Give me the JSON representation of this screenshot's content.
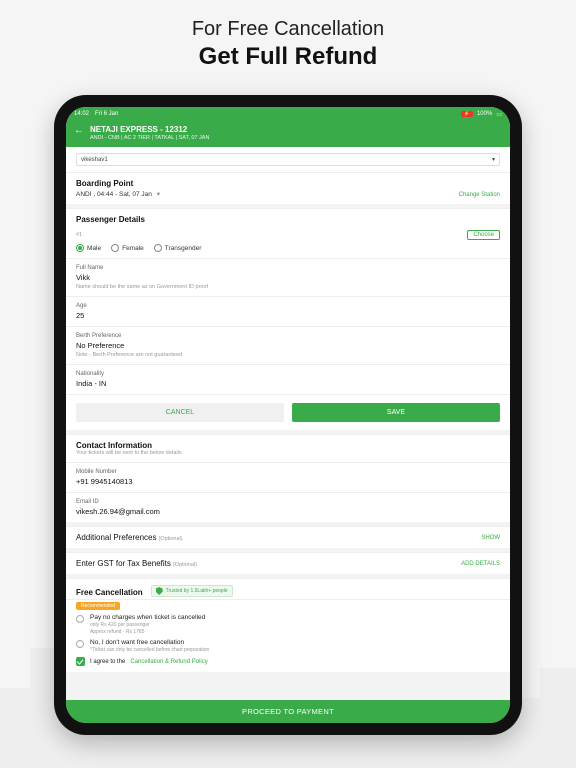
{
  "headline": {
    "line1": "For Free Cancellation",
    "line2": "Get Full Refund"
  },
  "statusbar": {
    "time": "14:02",
    "date": "Fri 6 Jan",
    "battery": "100%"
  },
  "appbar": {
    "back": "←",
    "title": "NETAJI EXPRESS - 12312",
    "subtitle": "ANDI - CNB | AC 2 TIER | TATKAL | SAT, 07 JAN"
  },
  "username_field": {
    "value": "vikeshav1",
    "caret": "▾"
  },
  "boarding": {
    "label": "Boarding Point",
    "value": "ANDI , 04:44 - Sat, 07 Jan",
    "caret": "▾",
    "change": "Change Station"
  },
  "passenger": {
    "heading": "Passenger Details",
    "idx": "#1",
    "choose": "Choose",
    "gender": {
      "male": "Male",
      "female": "Female",
      "trans": "Transgender"
    },
    "fullname_label": "Full Name",
    "fullname_value": "Vikk",
    "fullname_note": "Name should be the same as on Government ID proof",
    "age_label": "Age",
    "age_value": "25",
    "berth_label": "Berth Preference",
    "berth_value": "No Preference",
    "berth_note": "Note - Berth Preference are not guaranteed",
    "nat_label": "Nationality",
    "nat_value": "India - IN",
    "cancel": "CANCEL",
    "save": "SAVE"
  },
  "contact": {
    "heading": "Contact Information",
    "sub": "Your tickets will be sent to the below details",
    "mobile_label": "Mobile Number",
    "mobile_value": "+91 9945140813",
    "email_label": "Email ID",
    "email_value": "vikesh.26.94@gmail.com"
  },
  "addpref": {
    "label": "Additional Preferences",
    "optional": "(Optional)",
    "action": "SHOW"
  },
  "gst": {
    "label": "Enter GST for Tax Benefits",
    "optional": "(Optional)",
    "action": "ADD DETAILS"
  },
  "freecancel": {
    "label": "Free Cancellation",
    "trusted": "Trusted by 1.5Lakh+ people",
    "recommended": "Recommended",
    "opt1_main": "Pay no charges when ticket is cancelled",
    "opt1_sub": "only Rs 420 per passenger",
    "opt1_refund": "Approx refund - Rs 1785",
    "opt2_main": "No, I don't want free cancellation",
    "opt2_sub": "*Ticket can only be cancelled before chart preparation",
    "agree_prefix": "I agree to the",
    "agree_link": "Cancellation & Refund Policy"
  },
  "paybar": "PROCEED TO PAYMENT"
}
